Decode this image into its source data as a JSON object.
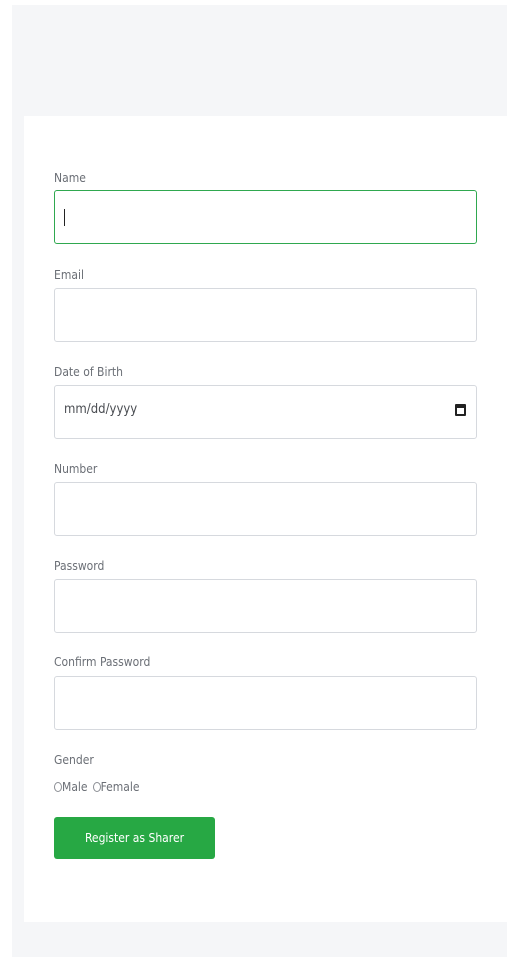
{
  "form": {
    "name_label": "Name",
    "name_value": "",
    "email_label": "Email",
    "email_value": "",
    "dob_label": "Date of Birth",
    "dob_placeholder": "mm/dd/yyyy",
    "number_label": "Number",
    "number_value": "",
    "password_label": "Password",
    "password_value": "",
    "confirm_password_label": "Confirm Password",
    "confirm_password_value": "",
    "gender_label": "Gender",
    "gender_options": [
      {
        "label": "Male",
        "selected": false
      },
      {
        "label": "Female",
        "selected": false
      }
    ],
    "submit_label": "Register as Sharer"
  },
  "colors": {
    "accent": "#27a844",
    "focus_border": "#2fa84f",
    "page_background": "#f5f6f8"
  },
  "icons": {
    "date_picker": "calendar-icon"
  }
}
